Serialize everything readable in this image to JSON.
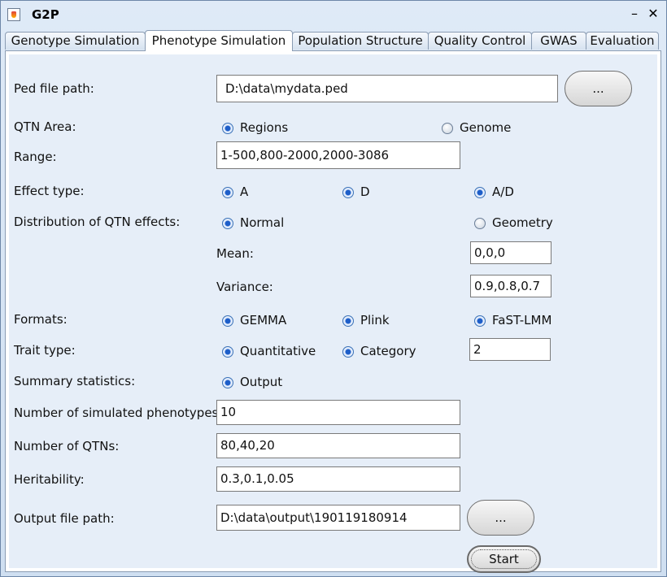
{
  "window": {
    "title": "G2P",
    "minimize_label": "–",
    "close_label": "✕"
  },
  "tabs": [
    {
      "label": "Genotype Simulation"
    },
    {
      "label": "Phenotype Simulation"
    },
    {
      "label": "Population Structure"
    },
    {
      "label": "Quality Control"
    },
    {
      "label": "GWAS"
    },
    {
      "label": "Evaluation"
    }
  ],
  "active_tab": "Phenotype Simulation",
  "form": {
    "ped_path": {
      "label": "Ped file path:",
      "value": "D:\\data\\mydata.ped",
      "browse_label": "..."
    },
    "qtn_area": {
      "label": "QTN Area:",
      "options": [
        "Regions",
        "Genome"
      ],
      "selected": "Regions"
    },
    "range": {
      "label": "Range:",
      "value": "1-500,800-2000,2000-3086"
    },
    "effect_type": {
      "label": "Effect type:",
      "options": [
        "A",
        "D",
        "A/D"
      ],
      "selected": [
        "A",
        "D",
        "A/D"
      ]
    },
    "distribution": {
      "label": "Distribution of QTN effects:",
      "options": [
        "Normal",
        "Geometry"
      ],
      "selected": "Normal"
    },
    "mean": {
      "label": "Mean:",
      "value": "0,0,0"
    },
    "variance": {
      "label": "Variance:",
      "value": "0.9,0.8,0.7"
    },
    "formats": {
      "label": "Formats:",
      "options": [
        "GEMMA",
        "Plink",
        "FaST-LMM"
      ],
      "selected": [
        "GEMMA",
        "Plink",
        "FaST-LMM"
      ]
    },
    "trait_type": {
      "label": "Trait type:",
      "options": [
        "Quantitative",
        "Category"
      ],
      "selected": [
        "Quantitative",
        "Category"
      ],
      "category_value": "2"
    },
    "summary": {
      "label": "Summary statistics:",
      "option": "Output",
      "selected": true
    },
    "num_phenotypes": {
      "label": "Number of simulated phenotypes:",
      "value": "10"
    },
    "num_qtns": {
      "label": "Number of QTNs:",
      "value": "80,40,20"
    },
    "heritability": {
      "label": "Heritability:",
      "value": "0.3,0.1,0.05"
    },
    "output_path": {
      "label": "Output file path:",
      "value": "D:\\data\\output\\190119180914",
      "browse_label": "..."
    },
    "start_label": "Start"
  }
}
